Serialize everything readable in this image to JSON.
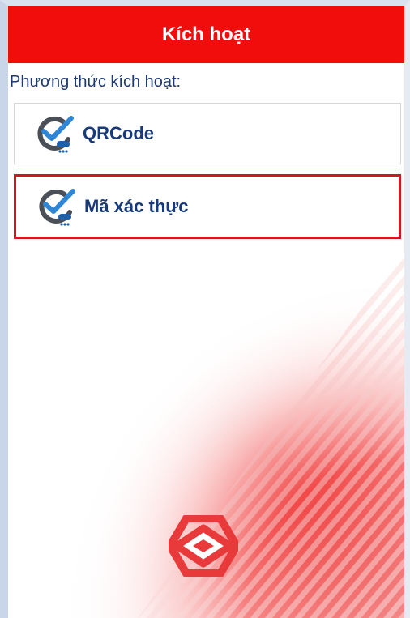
{
  "header": {
    "title": "Kích hoạt"
  },
  "activation": {
    "label": "Phương thức kích hoạt:",
    "methods": [
      {
        "label": "QRCode",
        "icon": "check-badge-icon",
        "selected": false
      },
      {
        "label": "Mã xác thực",
        "icon": "check-badge-icon",
        "selected": true
      }
    ]
  },
  "colors": {
    "header_bg": "#f20d0d",
    "text_blue": "#163a7a",
    "selected_border": "#d01824",
    "brand_red": "#e83a3a"
  }
}
